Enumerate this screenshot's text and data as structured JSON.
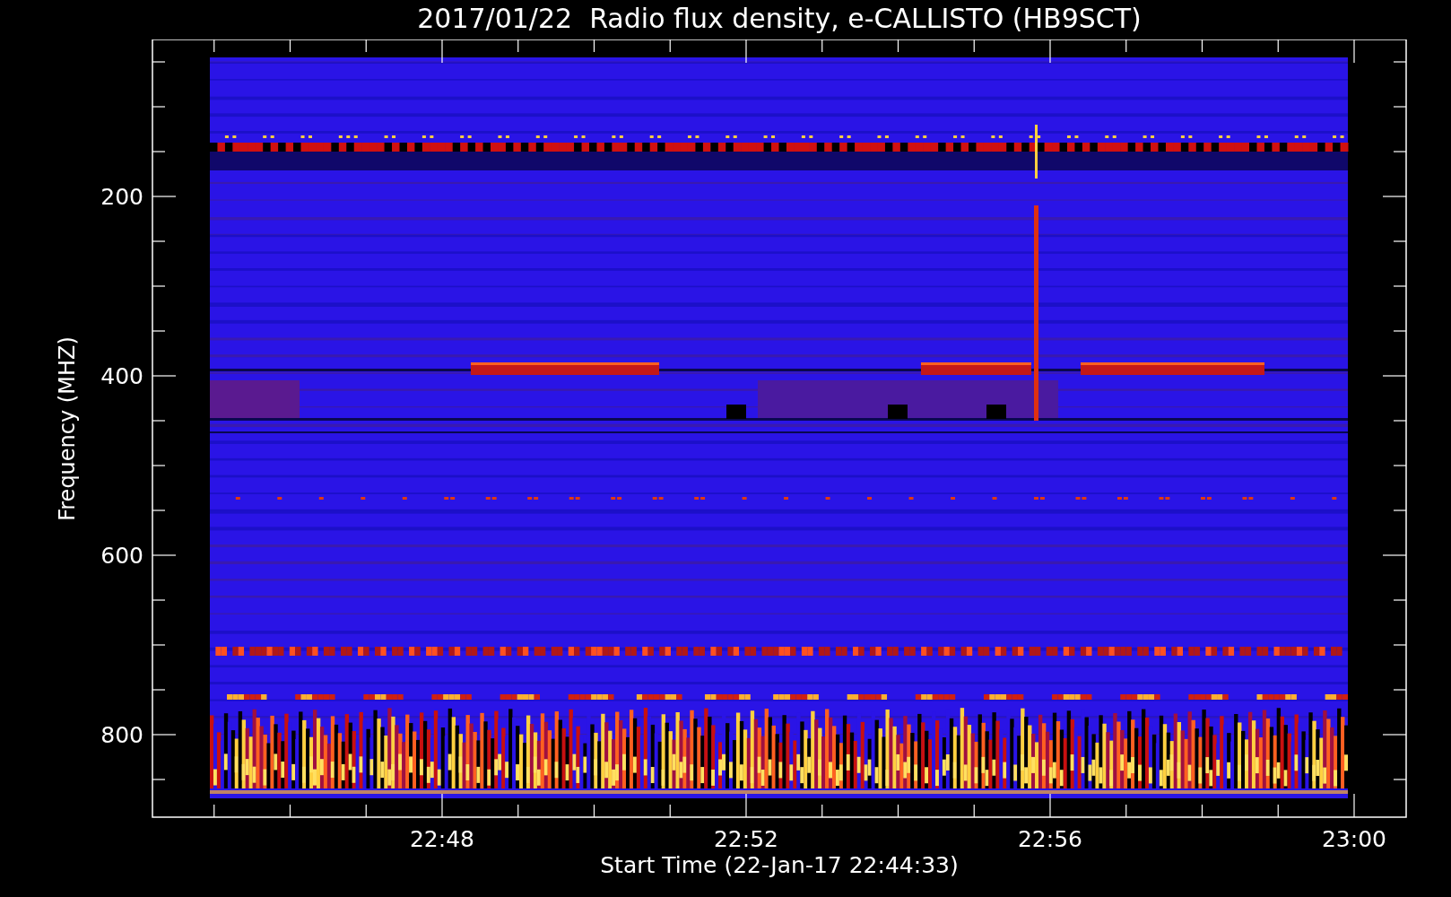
{
  "title": "2017/01/22  Radio flux density, e-CALLISTO (HB9SCT)",
  "y_axis": {
    "label": "Frequency (MHZ)",
    "ticks": [
      "200",
      "400",
      "600",
      "800"
    ]
  },
  "x_axis": {
    "label": "Start Time (22-Jan-17 22:44:33)",
    "ticks": [
      "22:48",
      "22:52",
      "22:56",
      "23:00"
    ]
  }
}
